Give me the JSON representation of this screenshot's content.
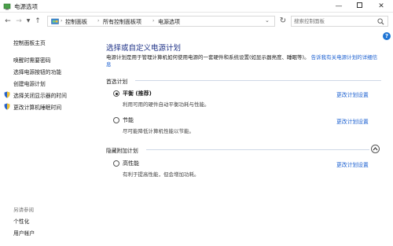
{
  "window": {
    "title": "电源选项"
  },
  "address": {
    "crumbs": [
      "控制面板",
      "所有控制面板项",
      "电源选项"
    ]
  },
  "search": {
    "placeholder": "搜索控制面板"
  },
  "sidebar": {
    "home": "控制面板主页",
    "items": [
      {
        "label": "唤醒时需要密码",
        "shield": false
      },
      {
        "label": "选择电源按钮的功能",
        "shield": false
      },
      {
        "label": "创建电源计划",
        "shield": false
      },
      {
        "label": "选择关闭显示器的时间",
        "shield": true
      },
      {
        "label": "更改计算机睡眠时间",
        "shield": true
      }
    ],
    "see_also": "另请参阅",
    "see_also_items": [
      "个性化",
      "用户帐户"
    ]
  },
  "main": {
    "title": "选择或自定义电源计划",
    "intro": "电源计划是用于管理计算机如何使用电源的一套硬件和系统设置(如显示器亮度、睡眠等)。",
    "intro_link": "告诉我有关电源计划的详细信息",
    "preferred_label": "首选计划",
    "hidden_label": "隐藏附加计划",
    "change_link": "更改计划设置",
    "plans": [
      {
        "name": "平衡 (推荐)",
        "desc": "利用可用的硬件自动平衡功耗与性能。",
        "checked": true
      },
      {
        "name": "节能",
        "desc": "尽可能降低计算机性能以节能。",
        "checked": false
      },
      {
        "name": "高性能",
        "desc": "有利于提高性能，但会增加功耗。",
        "checked": false
      }
    ]
  },
  "colors": {
    "accent_link": "#1a5fd0",
    "title_blue": "#1e3287",
    "help_blue": "#1e74d4"
  }
}
